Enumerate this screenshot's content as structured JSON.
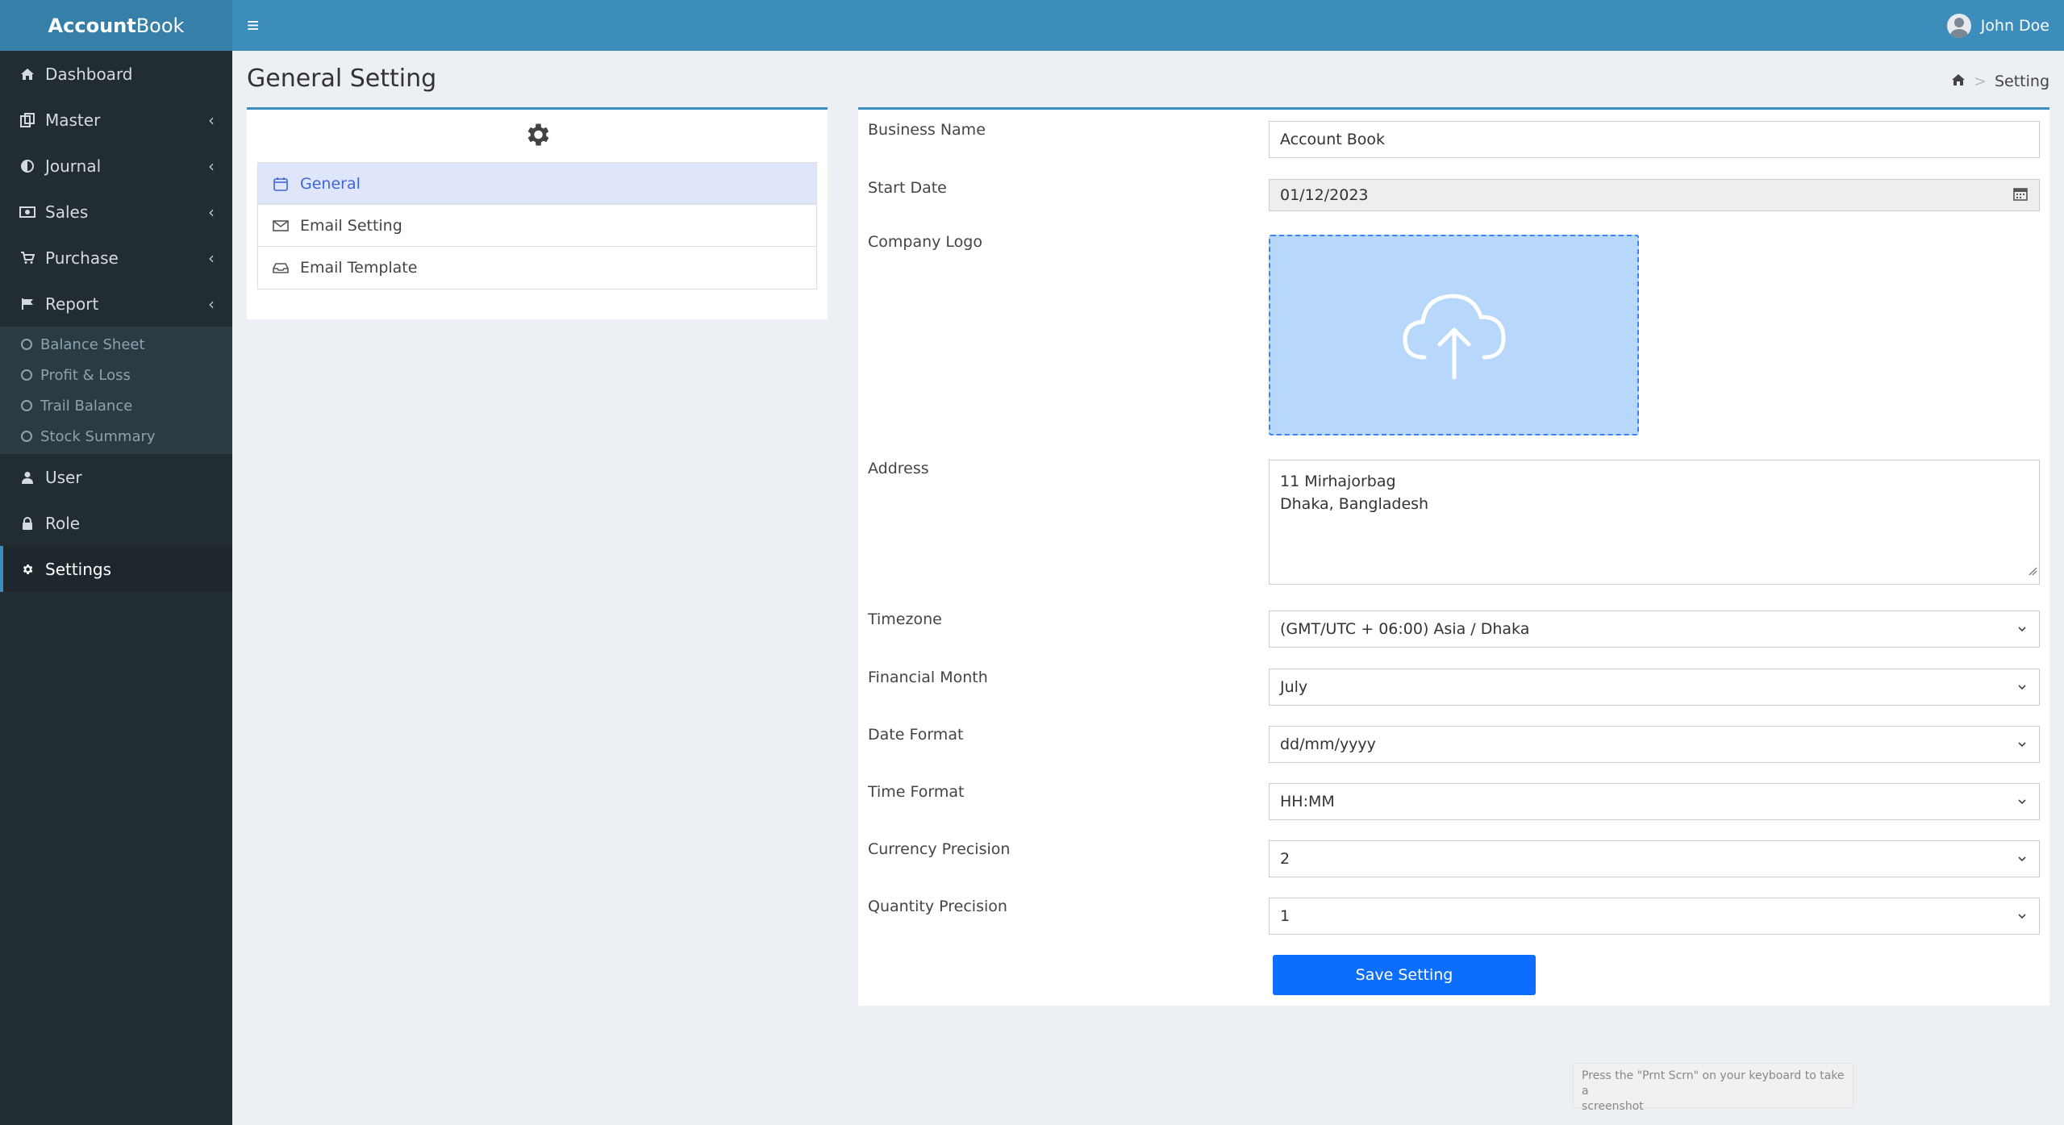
{
  "app": {
    "name_bold": "Account",
    "name_light": "Book"
  },
  "topbar": {
    "user_name": "John Doe"
  },
  "sidebar": {
    "items": [
      {
        "label": "Dashboard",
        "icon": "home-icon"
      },
      {
        "label": "Master",
        "icon": "copy-icon"
      },
      {
        "label": "Journal",
        "icon": "half-circle-icon"
      },
      {
        "label": "Sales",
        "icon": "money-icon"
      },
      {
        "label": "Purchase",
        "icon": "cart-icon"
      },
      {
        "label": "Report",
        "icon": "flag-icon"
      },
      {
        "label": "User",
        "icon": "user-icon"
      },
      {
        "label": "Role",
        "icon": "lock-icon"
      },
      {
        "label": "Settings",
        "icon": "gear-icon"
      }
    ],
    "report_sub": [
      "Balance Sheet",
      "Profit & Loss",
      "Trail Balance",
      "Stock Summary"
    ]
  },
  "page": {
    "title": "General Setting",
    "breadcrumb": "Setting"
  },
  "setting_nav": [
    "General",
    "Email Setting",
    "Email Template"
  ],
  "form": {
    "business_name": {
      "label": "Business Name",
      "value": "Account Book"
    },
    "start_date": {
      "label": "Start Date",
      "value": "01/12/2023"
    },
    "company_logo": {
      "label": "Company Logo"
    },
    "address": {
      "label": "Address",
      "line1": "11 Mirhajorbag",
      "line2": "Dhaka, Bangladesh"
    },
    "timezone": {
      "label": "Timezone",
      "value": "(GMT/UTC + 06:00) Asia / Dhaka"
    },
    "financial_month": {
      "label": "Financial Month",
      "value": "July"
    },
    "date_format": {
      "label": "Date Format",
      "value": "dd/mm/yyyy"
    },
    "time_format": {
      "label": "Time Format",
      "value": "HH:MM"
    },
    "currency_precision": {
      "label": "Currency Precision",
      "value": "2"
    },
    "quantity_precision": {
      "label": "Quantity Precision",
      "value": "1"
    },
    "save_label": "Save Setting"
  },
  "tooltip": {
    "line1": "Press the \"Prnt Scrn\" on your keyboard to take a",
    "line2": "screenshot"
  },
  "colors": {
    "sidebar": "#222d32",
    "topbar": "#3c8dbc",
    "primary_button": "#0d6efd",
    "active_nav": "#dfe6fb"
  }
}
